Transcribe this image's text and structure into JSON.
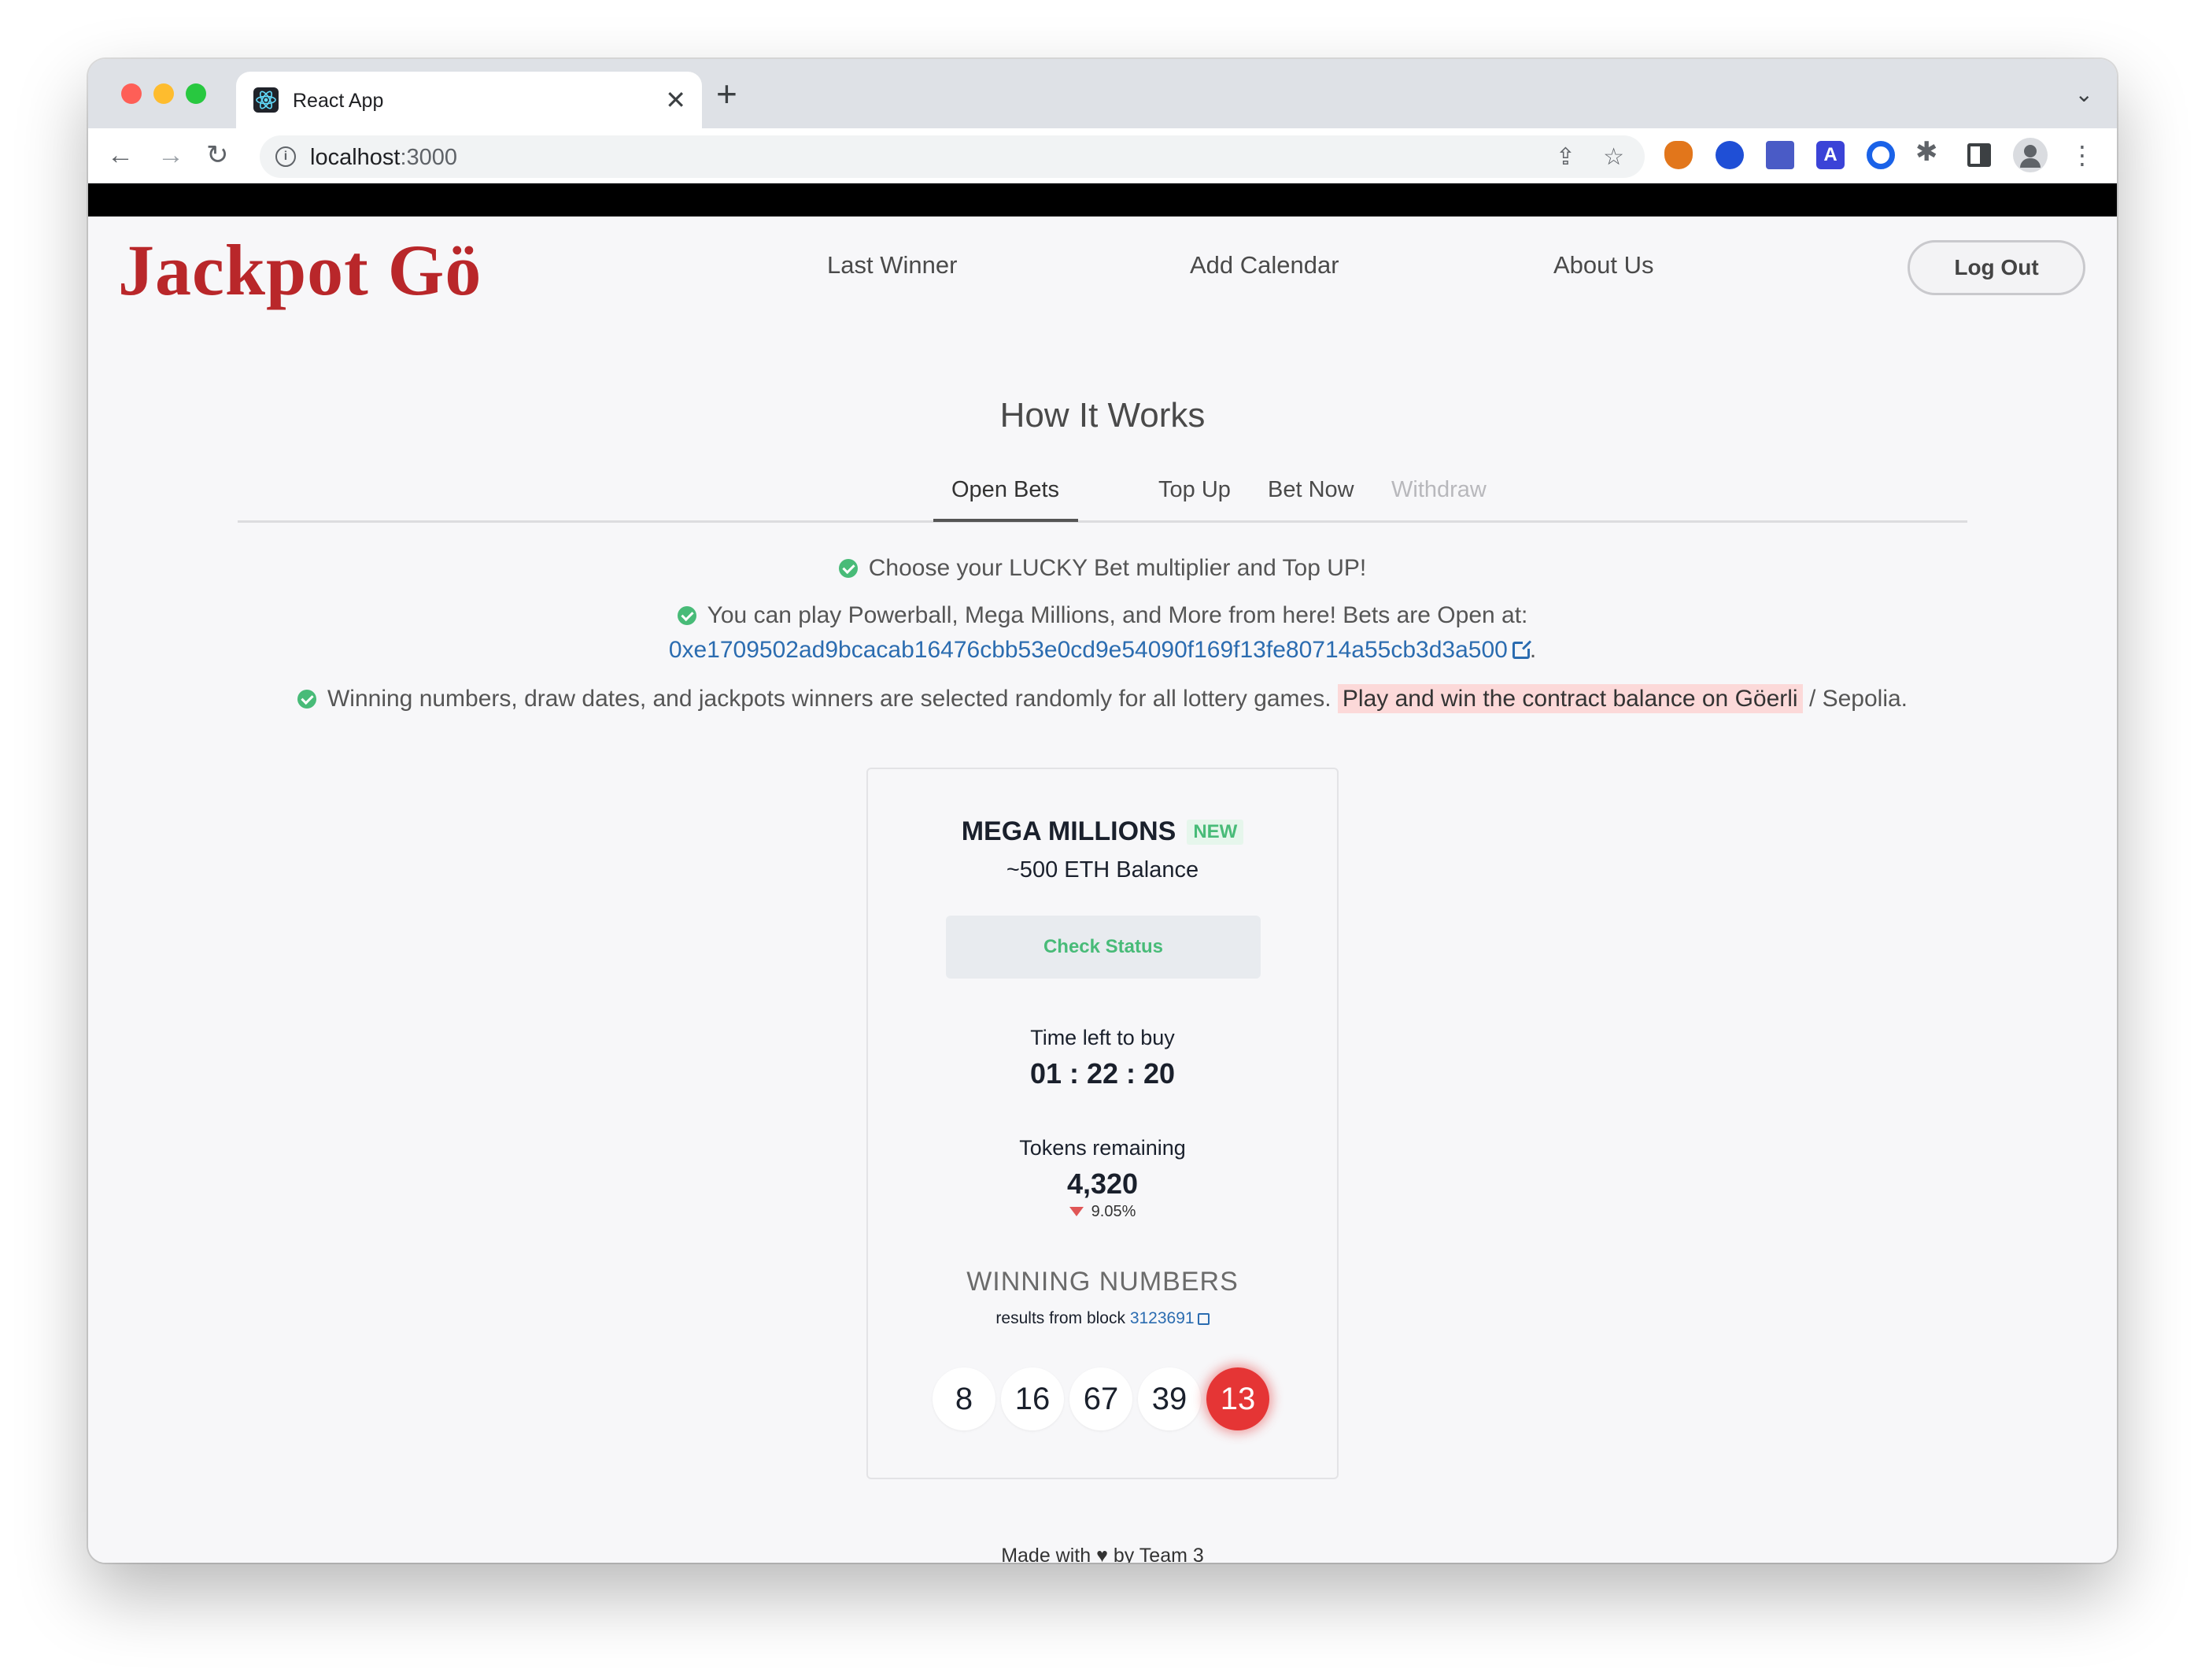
{
  "browser": {
    "tab_title": "React App",
    "tab_close": "✕",
    "new_tab": "+",
    "tab_dropdown": "⌄",
    "url_host": "localhost",
    "url_port": ":3000",
    "nav": {
      "back": "←",
      "forward": "→",
      "reload": "↻"
    },
    "icons": {
      "share": "⇪",
      "star": "☆",
      "puzzle": "✱",
      "menu": "⋮",
      "info": "i",
      "ext_a": "A"
    }
  },
  "header": {
    "logo": "Jackpot Gö",
    "nav": [
      "Last Winner",
      "Add Calendar",
      "About Us"
    ],
    "logout": "Log Out"
  },
  "main": {
    "title": "How It Works",
    "tabs": [
      "Open Bets",
      "Top Up",
      "Bet Now",
      "Withdraw"
    ],
    "active_tab": "Open Bets",
    "lines": {
      "l1": "Choose your LUCKY Bet multiplier and Top UP!",
      "l2": "You can play Powerball, Mega Millions, and More from here! Bets are Open at:",
      "address": "0xe1709502ad9bcacab16476cbb53e0cd9e54090f169f13fe80714a55cb3d3a500",
      "address_suffix": ".",
      "l3_a": "Winning numbers, draw dates, and jackpots winners are selected randomly for all lottery games.",
      "l3_highlight": "Play and win the contract balance on Göerli",
      "l3_b": "/ Sepolia."
    }
  },
  "card": {
    "title": "MEGA MILLIONS",
    "badge": "NEW",
    "balance": "~500 ETH Balance",
    "check_status": "Check Status",
    "time_label": "Time left to buy",
    "time_value": "01 : 22 : 20",
    "tokens_label": "Tokens remaining",
    "tokens_value": "4,320",
    "tokens_change": "9.05%",
    "winning_title": "WINNING NUMBERS",
    "results_prefix": "results from block",
    "block": "3123691",
    "numbers": [
      "8",
      "16",
      "67",
      "39",
      "13"
    ]
  },
  "footer": {
    "before": "Made with",
    "heart": "♥",
    "after": "by Team 3"
  },
  "colors": {
    "brand": "#b9272a",
    "success": "#48bb78",
    "link": "#2b6cb0",
    "power_ball": "#e53535"
  }
}
